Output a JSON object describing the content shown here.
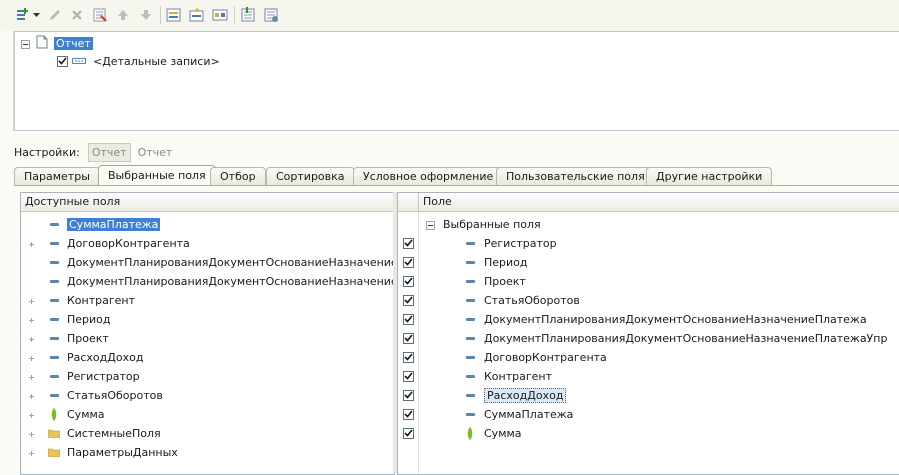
{
  "toolbar": {
    "icons": [
      "add-icon",
      "edit-icon",
      "delete-icon",
      "properties-icon",
      "move-up-icon",
      "move-down-icon",
      "group-icon",
      "group-up-icon",
      "group-alt-icon",
      "settings-icon",
      "settings-alt-icon"
    ]
  },
  "structure": {
    "root": {
      "label": "Отчет",
      "selected": true
    },
    "child": {
      "label": "<Детальные записи>",
      "checked": true
    }
  },
  "settings": {
    "label": "Настройки:",
    "mode_pressed": "Отчет",
    "mode_plain": "Отчет"
  },
  "tabs": [
    {
      "label": "Параметры",
      "active": false
    },
    {
      "label": "Выбранные поля",
      "active": true
    },
    {
      "label": "Отбор",
      "active": false
    },
    {
      "label": "Сортировка",
      "active": false
    },
    {
      "label": "Условное оформление",
      "active": false
    },
    {
      "label": "Пользовательские поля",
      "active": false
    },
    {
      "label": "Другие настройки",
      "active": false
    }
  ],
  "available_fields": {
    "header": "Доступные поля",
    "items": [
      {
        "label": "СуммаПлатежа",
        "icon": "field-icon",
        "expandable": false,
        "selected": true
      },
      {
        "label": "ДоговорКонтрагента",
        "icon": "field-icon",
        "expandable": true
      },
      {
        "label": "ДокументПланированияДокументОснованиеНазначениеПлатежа",
        "icon": "field-icon",
        "expandable": false
      },
      {
        "label": "ДокументПланированияДокументОснованиеНазначениеПлатежаУпр",
        "icon": "field-icon",
        "expandable": false
      },
      {
        "label": "Контрагент",
        "icon": "field-icon",
        "expandable": true
      },
      {
        "label": "Период",
        "icon": "field-icon",
        "expandable": true
      },
      {
        "label": "Проект",
        "icon": "field-icon",
        "expandable": true
      },
      {
        "label": "РасходДоход",
        "icon": "field-icon",
        "expandable": true
      },
      {
        "label": "Регистратор",
        "icon": "field-icon",
        "expandable": true
      },
      {
        "label": "СтатьяОборотов",
        "icon": "field-icon",
        "expandable": true
      },
      {
        "label": "Сумма",
        "icon": "resource-icon",
        "expandable": true
      },
      {
        "label": "СистемныеПоля",
        "icon": "folder-icon",
        "expandable": true
      },
      {
        "label": "ПараметрыДанных",
        "icon": "folder-icon",
        "expandable": true
      }
    ]
  },
  "selected_fields": {
    "header": "Поле",
    "group_label": "Выбранные поля",
    "items": [
      {
        "label": "Регистратор",
        "icon": "field-icon",
        "checked": true
      },
      {
        "label": "Период",
        "icon": "field-icon",
        "checked": true
      },
      {
        "label": "Проект",
        "icon": "field-icon",
        "checked": true
      },
      {
        "label": "СтатьяОборотов",
        "icon": "field-icon",
        "checked": true
      },
      {
        "label": "ДокументПланированияДокументОснованиеНазначениеПлатежа",
        "icon": "field-icon",
        "checked": true
      },
      {
        "label": "ДокументПланированияДокументОснованиеНазначениеПлатежаУпр",
        "icon": "field-icon",
        "checked": true
      },
      {
        "label": "ДоговорКонтрагента",
        "icon": "field-icon",
        "checked": true
      },
      {
        "label": "Контрагент",
        "icon": "field-icon",
        "checked": true
      },
      {
        "label": "РасходДоход",
        "icon": "field-icon",
        "checked": true,
        "focused": true
      },
      {
        "label": "СуммаПлатежа",
        "icon": "field-icon",
        "checked": true
      },
      {
        "label": "Сумма",
        "icon": "resource-icon",
        "checked": true
      }
    ]
  },
  "colors": {
    "selection": "#3f7fd4",
    "field_icon": "#5d86ad",
    "resource_icon": "#7dbb2a",
    "folder_icon": "#e7c45a"
  }
}
